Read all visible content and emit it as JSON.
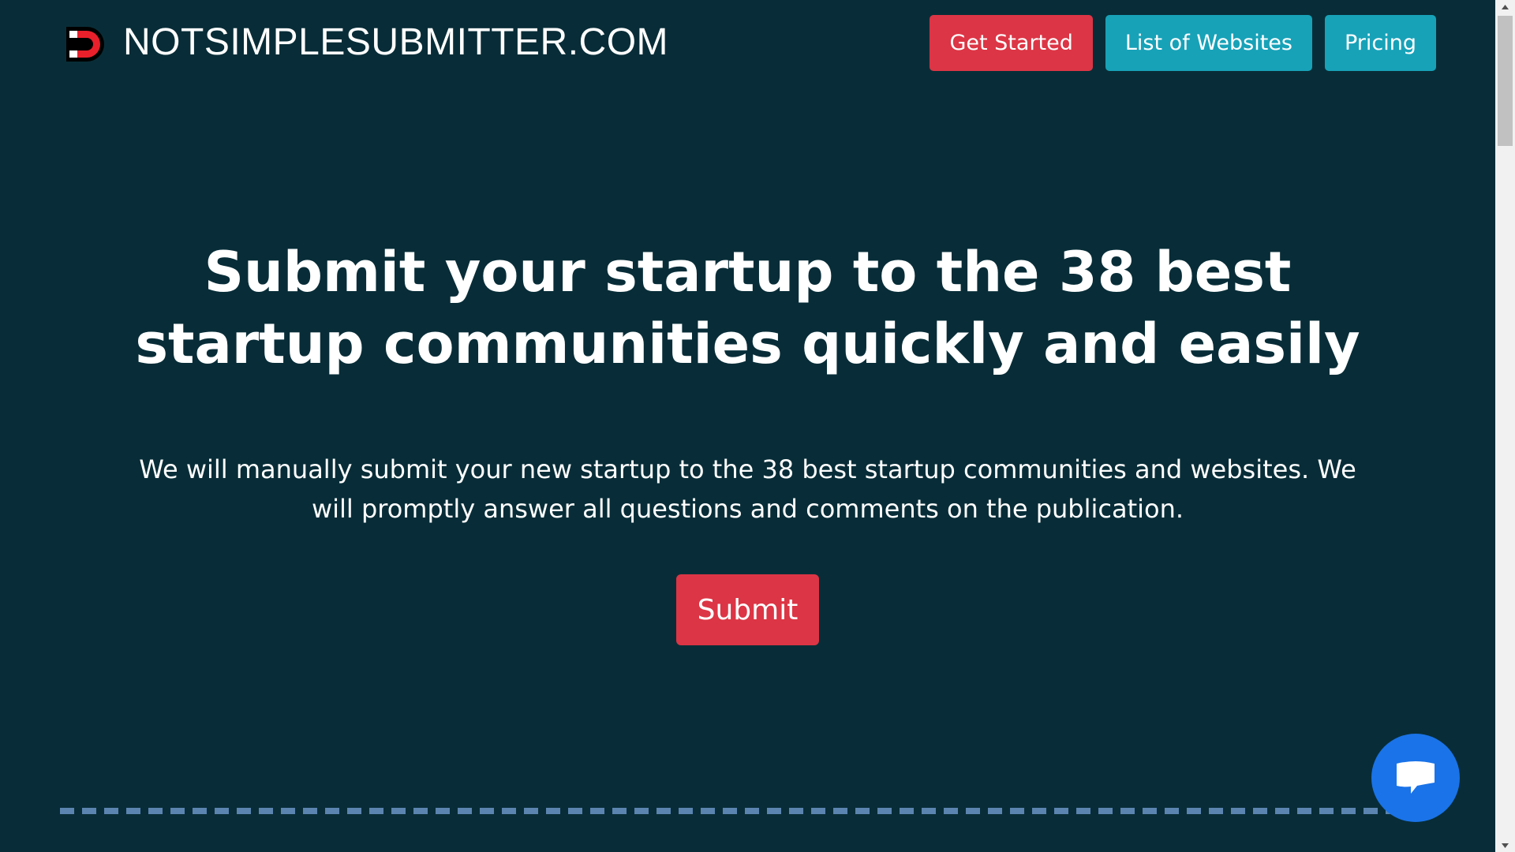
{
  "header": {
    "logo_text": "NOTSIMPLESUBMITTER.COM",
    "logo_icon": "magnet-icon",
    "nav": [
      {
        "label": "Get Started",
        "color": "#dc3545"
      },
      {
        "label": "List of Websites",
        "color": "#17a2b8"
      },
      {
        "label": "Pricing",
        "color": "#17a2b8"
      }
    ]
  },
  "hero": {
    "title": "Submit your startup to the 38 best startup communities quickly and easily",
    "description": "We will manually submit your new startup to the 38 best startup communities and websites. We will promptly answer all questions and comments on the publication.",
    "submit_label": "Submit"
  },
  "chat": {
    "icon": "chat-bubble-icon",
    "color": "#1a73e8"
  },
  "theme": {
    "background": "#082d38",
    "accent_red": "#dc3545",
    "accent_teal": "#17a2b8",
    "divider": "#5b84b0"
  }
}
